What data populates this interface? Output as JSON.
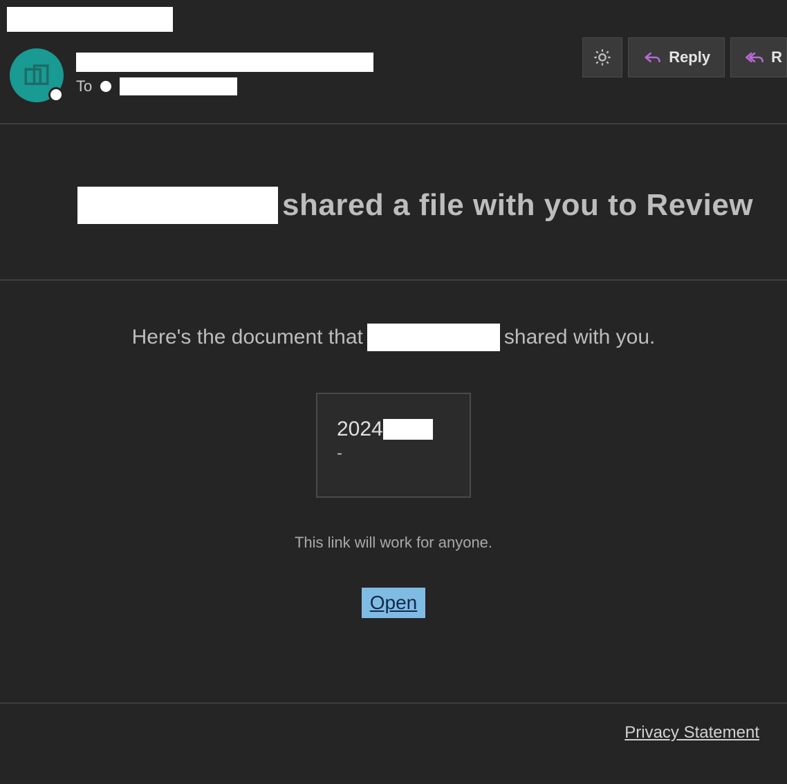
{
  "header": {
    "to_label": "To",
    "actions": {
      "reply_label": "Reply",
      "reply_all_partial": "R"
    }
  },
  "hero": {
    "suffix": "shared a file with you to Review"
  },
  "body": {
    "prefix": "Here's the document that",
    "suffix": "shared with you."
  },
  "document": {
    "name_prefix": "2024"
  },
  "note": "This link will work for anyone.",
  "open_label": "Open",
  "footer": {
    "privacy_label": "Privacy Statement"
  }
}
